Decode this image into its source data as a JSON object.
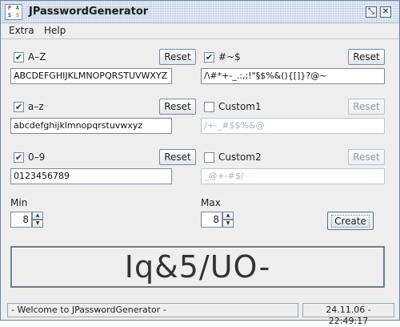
{
  "window": {
    "title": "JPasswordGenerator",
    "icon_letters": [
      "P",
      "A",
      "S",
      "S"
    ],
    "restore_glyph": "⤡",
    "close_glyph": "✕"
  },
  "menu": {
    "items": [
      "Extra",
      "Help"
    ]
  },
  "groups": {
    "uppercase": {
      "checked": true,
      "label": "A–Z",
      "reset": "Reset",
      "value": "ABCDEFGHIJKLMNOPQRSTUVWXYZ"
    },
    "special": {
      "checked": true,
      "label": "#~$",
      "reset": "Reset",
      "value": "/\\#*+-_.:,;!\"§$%&(){[]}?@~"
    },
    "lowercase": {
      "checked": true,
      "label": "a–z",
      "reset": "Reset",
      "value": "abcdefghijklmnopqrstuvwxyz"
    },
    "custom1": {
      "checked": false,
      "label": "Custom1",
      "reset": "Reset",
      "value": "/+-_#$$%&@"
    },
    "digits": {
      "checked": true,
      "label": "0–9",
      "reset": "Reset",
      "value": "0123456789"
    },
    "custom2": {
      "checked": false,
      "label": "Custom2",
      "reset": "Reset",
      "value": "_@+-#$/"
    }
  },
  "length": {
    "min_label": "Min",
    "min_value": "8",
    "max_label": "Max",
    "max_value": "8",
    "up_glyph": "▲",
    "down_glyph": "▼"
  },
  "create_label": "Create",
  "password": "Iq&5/UO-",
  "status": {
    "message": "- Welcome to JPasswordGenerator -",
    "datetime": "24.11.06 - 22:49:17"
  },
  "colors": {
    "titlebar": "#c9d6e6",
    "disabled_text": "#a5b3c3",
    "check_mark": "#1a3d6e"
  },
  "check_glyph": "✔"
}
